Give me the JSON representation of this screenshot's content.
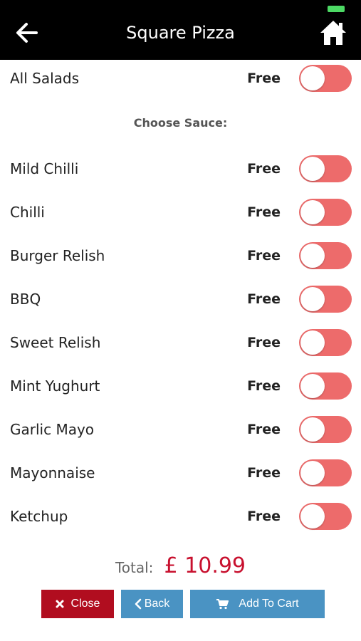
{
  "header": {
    "title": "Square Pizza",
    "back_icon": "arrow-left-icon",
    "home_icon": "home-icon",
    "battery_color": "#4cd964"
  },
  "options": {
    "top": {
      "name": "All Salads",
      "price": "Free"
    },
    "sauce_heading": "Choose Sauce:",
    "sauces": [
      {
        "name": "Mild Chilli",
        "price": "Free"
      },
      {
        "name": "Chilli",
        "price": "Free"
      },
      {
        "name": "Burger Relish",
        "price": "Free"
      },
      {
        "name": "BBQ",
        "price": "Free"
      },
      {
        "name": "Sweet Relish",
        "price": "Free"
      },
      {
        "name": "Mint Yughurt",
        "price": "Free"
      },
      {
        "name": "Garlic Mayo",
        "price": "Free"
      },
      {
        "name": "Mayonnaise",
        "price": "Free"
      },
      {
        "name": "Ketchup",
        "price": "Free"
      }
    ],
    "toggle_off_color": "#ed6b6b"
  },
  "footer": {
    "total_label": "Total:",
    "total_value": "£ 10.99",
    "total_color": "#c8102e",
    "close_label": "Close",
    "back_label": "Back",
    "cart_label": "Add To Cart",
    "close_color": "#b10d1f",
    "primary_color": "#4a93c3"
  }
}
